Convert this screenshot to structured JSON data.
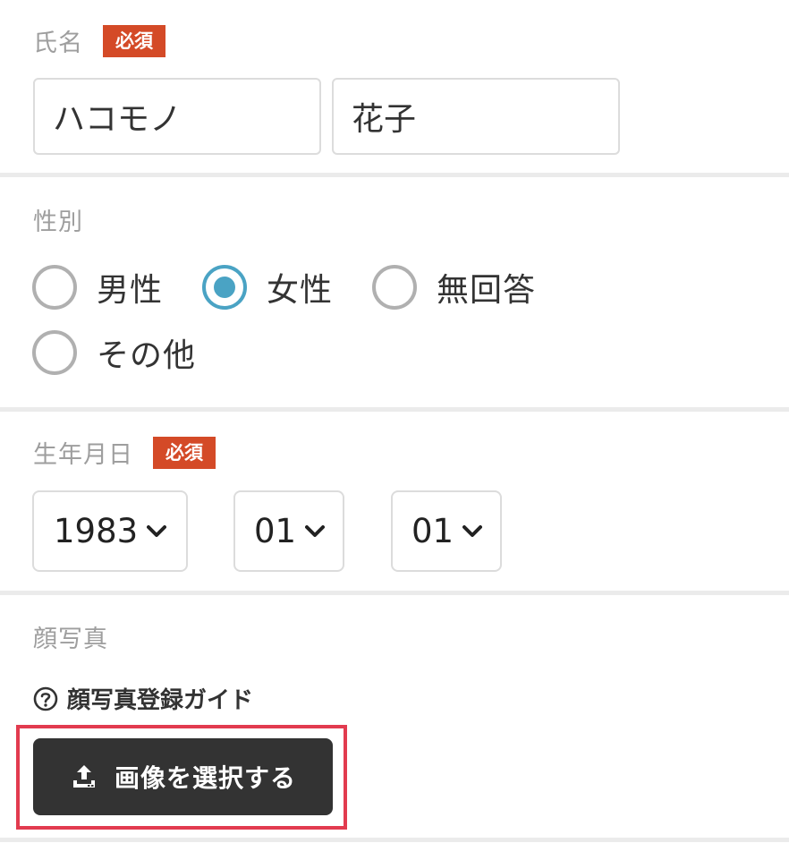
{
  "name_section": {
    "label": "氏名",
    "required_badge": "必須",
    "last_name_value": "ハコモノ",
    "first_name_value": "花子"
  },
  "gender_section": {
    "label": "性別",
    "options": [
      {
        "label": "男性",
        "checked": false
      },
      {
        "label": "女性",
        "checked": true
      },
      {
        "label": "無回答",
        "checked": false
      },
      {
        "label": "その他",
        "checked": false
      }
    ]
  },
  "birthday_section": {
    "label": "生年月日",
    "required_badge": "必須",
    "year": "1983",
    "month": "01",
    "day": "01"
  },
  "photo_section": {
    "label": "顔写真",
    "guide_link": "顔写真登録ガイド",
    "upload_button": "画像を選択する"
  },
  "colors": {
    "badge": "#d44a27",
    "radio_checked": "#4aa3c4",
    "button_bg": "#333333",
    "highlight": "#e23b4f"
  },
  "icons": [
    "chevron-down-icon",
    "help-icon",
    "upload-icon"
  ]
}
